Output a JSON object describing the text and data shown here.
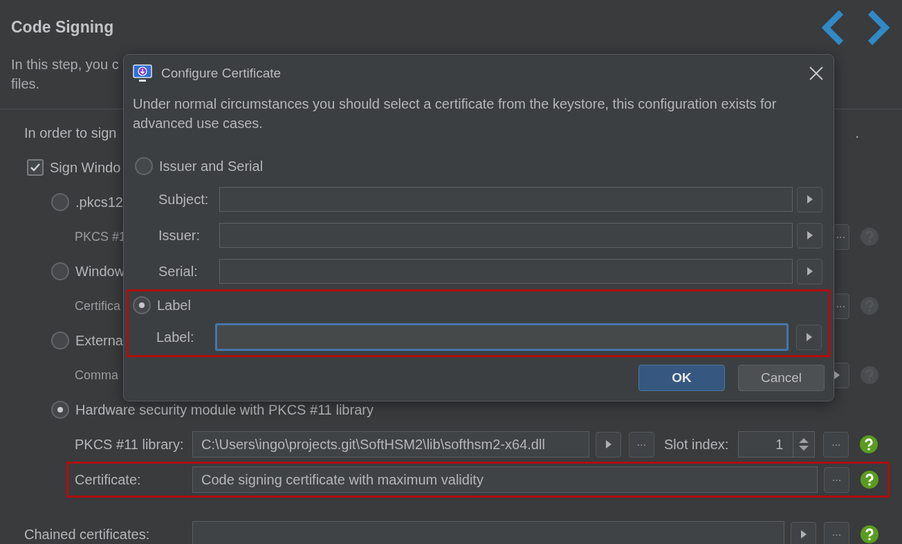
{
  "page": {
    "title": "Code Signing",
    "description": [
      "In this step, you c",
      "files."
    ]
  },
  "intro": {
    "text": "In order to sign",
    "end": "."
  },
  "sign_windows": {
    "label": "Sign Windo",
    "checked": true
  },
  "methods": [
    {
      "label": ".pkcs12",
      "selected": false,
      "detail": {
        "label": "PKCS #1",
        "disabled": true,
        "control": {
          "kind": "more",
          "text": "..."
        },
        "help_active": false
      }
    },
    {
      "label": "Window",
      "selected": false,
      "detail": {
        "label": "Certifica",
        "disabled": true,
        "control": {
          "kind": "more",
          "text": "..."
        },
        "help_active": false
      }
    },
    {
      "label": "Externa",
      "selected": false,
      "detail": {
        "label": "Comma",
        "disabled": true,
        "control": {
          "kind": "arrow"
        },
        "help_active": false
      }
    },
    {
      "label": "Hardware security module with PKCS #11 library",
      "selected": true
    }
  ],
  "library": {
    "label": "PKCS #11 library:",
    "value": "C:\\Users\\ingo\\projects.git\\SoftHSM2\\lib\\softhsm2-x64.dll",
    "more": "...",
    "slot_label": "Slot index:",
    "slot_value": "1",
    "slot_more": "...",
    "help_active": true
  },
  "certificate": {
    "label": "Certificate:",
    "value": "Code signing certificate with maximum validity",
    "more": "...",
    "highlighted": true,
    "help_active": true
  },
  "chained": {
    "label": "Chained certificates:",
    "more": "...",
    "help_active": true
  },
  "dialog": {
    "title": "Configure Certificate",
    "description": "Under normal circumstances you should select a certificate from the keystore, this configuration exists for advanced use cases.",
    "options": [
      {
        "label": "Issuer and Serial",
        "selected": false,
        "highlighted": false,
        "fields": [
          {
            "label": "Subject:",
            "focused": false
          },
          {
            "label": "Issuer:",
            "focused": false
          },
          {
            "label": "Serial:",
            "focused": false
          }
        ]
      },
      {
        "label": "Label",
        "selected": true,
        "highlighted": true,
        "fields": [
          {
            "label": "Label:",
            "focused": true
          }
        ]
      }
    ],
    "buttons": [
      {
        "label": "OK",
        "default": true
      },
      {
        "label": "Cancel",
        "default": false
      }
    ]
  }
}
